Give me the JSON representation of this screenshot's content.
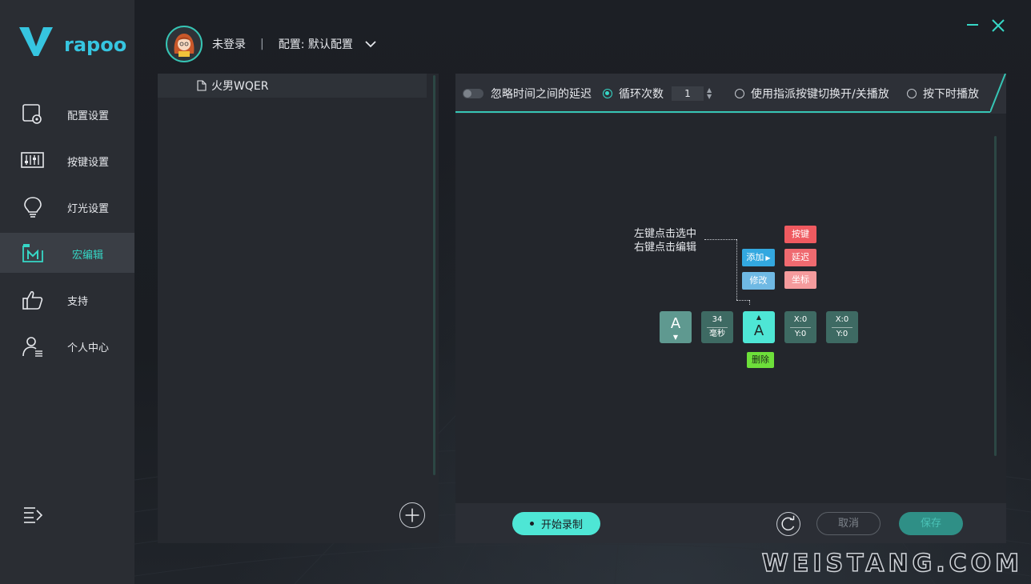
{
  "brand": {
    "name": "rapoo",
    "accent": "#36c5e0",
    "teal": "#36d7c6"
  },
  "sidebar": {
    "items": [
      {
        "label": "配置设置",
        "icon": "config-settings-icon"
      },
      {
        "label": "按键设置",
        "icon": "key-settings-icon"
      },
      {
        "label": "灯光设置",
        "icon": "lighting-bulb-icon"
      },
      {
        "label": "宏编辑",
        "icon": "macro-edit-icon",
        "active": true
      },
      {
        "label": "支持",
        "icon": "thumbs-up-icon"
      },
      {
        "label": "个人中心",
        "icon": "user-center-icon"
      }
    ]
  },
  "header": {
    "user": "未登录",
    "separator": "|",
    "profile": "配置: 默认配置"
  },
  "macro_list": {
    "items": [
      {
        "name": "火男WQER"
      }
    ]
  },
  "options": {
    "ignore_delay": "忽略时间之间的延迟",
    "loop_count_label": "循环次数",
    "loop_count_value": "1",
    "toggle_play": "使用指派按键切换开/关播放",
    "hold_play": "按下时播放"
  },
  "editor": {
    "hint_line1": "左键点击选中",
    "hint_line2": "右键点击编辑",
    "add_label": "添加",
    "modify_label": "修改",
    "submenu": {
      "key": "按键",
      "delay": "延迟",
      "coord": "坐标"
    },
    "delete_label": "删除",
    "nodes": [
      {
        "type": "key",
        "key": "A",
        "direction": "down"
      },
      {
        "type": "delay",
        "value": "34",
        "unit": "毫秒"
      },
      {
        "type": "key",
        "key": "A",
        "direction": "up"
      },
      {
        "type": "coord",
        "x": "X:0",
        "y": "Y:0"
      },
      {
        "type": "coord",
        "x": "X:0",
        "y": "Y:0"
      }
    ]
  },
  "footer": {
    "record": "开始录制",
    "cancel": "取消",
    "save": "保存"
  },
  "watermark": "WEISTANG.COM"
}
